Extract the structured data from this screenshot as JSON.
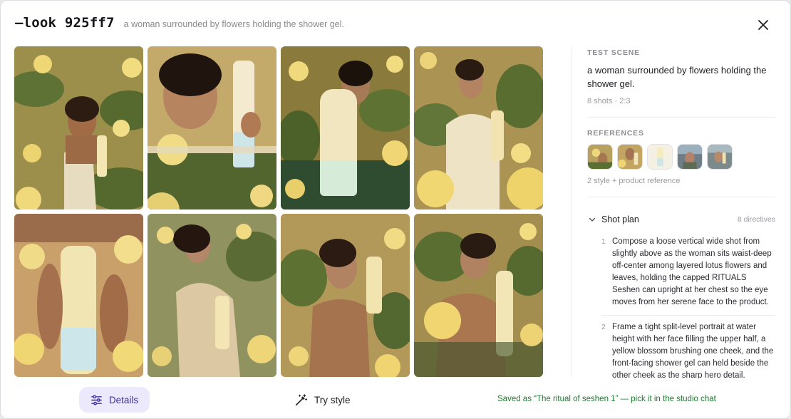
{
  "header": {
    "look_id": "—look 925ff7",
    "subtitle": "a woman surrounded by flowers holding the shower gel."
  },
  "icons": {
    "close": "close-icon",
    "details": "sliders-icon",
    "try_style": "magic-wand-icon",
    "collapse": "chevron-down-icon"
  },
  "shots": [
    {
      "alt": "shot-1"
    },
    {
      "alt": "shot-2"
    },
    {
      "alt": "shot-3"
    },
    {
      "alt": "shot-4"
    },
    {
      "alt": "shot-5"
    },
    {
      "alt": "shot-6"
    },
    {
      "alt": "shot-7"
    },
    {
      "alt": "shot-8"
    }
  ],
  "test_scene": {
    "label": "TEST SCENE",
    "text": "a woman surrounded by flowers holding the shower gel.",
    "meta": "8 shots · 2:3"
  },
  "references": {
    "label": "REFERENCES",
    "caption": "2 style + product reference"
  },
  "shot_plan": {
    "title": "Shot plan",
    "count": "8 directives",
    "directives": [
      {
        "num": "1",
        "text": "Compose a loose vertical wide shot from slightly above as the woman sits waist-deep off-center among layered lotus flowers and leaves, holding the capped RITUALS Seshen can upright at her chest so the eye moves from her serene face to the product."
      },
      {
        "num": "2",
        "text": "Frame a tight split-level portrait at water height with her face filling the upper half, a yellow blossom brushing one cheek, and the front-facing shower gel can held beside the other cheek as the sharp hero detail."
      }
    ]
  },
  "footer": {
    "details_label": "Details",
    "try_style_label": "Try style",
    "saved_message": "Saved as “The ritual of seshen 1” — pick it in the studio chat"
  },
  "colors": {
    "accent": "#3b2fa8",
    "accent_bg": "#ebe9fb",
    "success": "#1e7b2f",
    "muted": "#9a9aa2"
  }
}
